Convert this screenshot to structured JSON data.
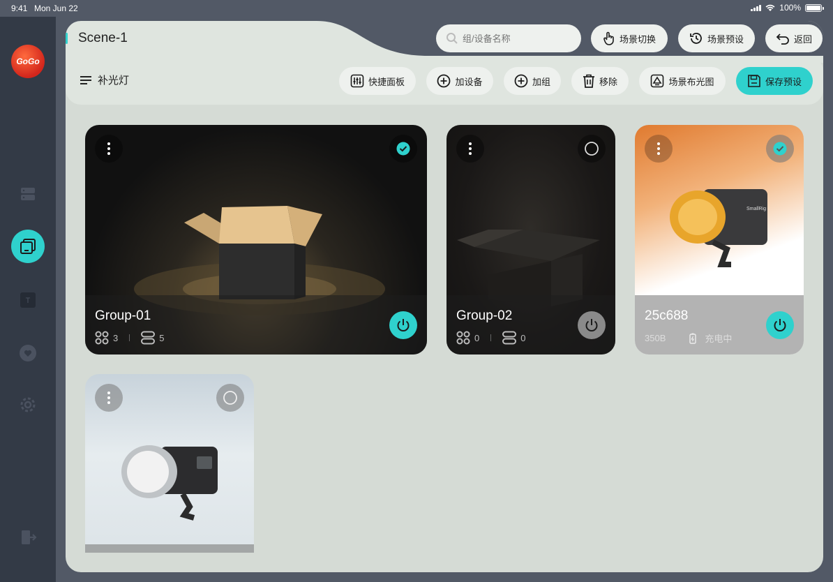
{
  "status_bar": {
    "time": "9:41",
    "date": "Mon Jun 22",
    "battery": "100%"
  },
  "sidebar": {
    "logo": "GoGo",
    "items": [
      {
        "name": "devices",
        "icon": "device-list-icon"
      },
      {
        "name": "scenes",
        "icon": "scene-icon",
        "active": true
      },
      {
        "name": "text",
        "icon": "text-icon"
      },
      {
        "name": "favorites",
        "icon": "heart-icon"
      },
      {
        "name": "settings",
        "icon": "gear-icon"
      },
      {
        "name": "exit",
        "icon": "exit-icon"
      }
    ]
  },
  "header": {
    "scene_title": "Scene-1",
    "search_placeholder": "组/设备名称",
    "switch_scene": "场景切换",
    "scene_preset": "场景预设",
    "back": "返回"
  },
  "toolbar": {
    "menu_label": "补光灯",
    "quick_panel": "快捷面板",
    "add_device": "加设备",
    "add_group": "加组",
    "remove": "移除",
    "scene_layout": "场景布光图",
    "save_preset": "保存预设"
  },
  "cards": [
    {
      "name": "Group-01",
      "groups": "3",
      "devices": "5",
      "selected": true,
      "power": "on"
    },
    {
      "name": "Group-02",
      "groups": "0",
      "devices": "0",
      "selected": false,
      "power": "off"
    },
    {
      "name": "25c688",
      "model": "350B",
      "charging": "充电中",
      "selected": true,
      "power": "on"
    },
    {
      "name": "",
      "selected": false
    }
  ],
  "colors": {
    "accent": "#2fd1cd",
    "sidebar": "#333a46",
    "panel": "#d5dbd5"
  }
}
